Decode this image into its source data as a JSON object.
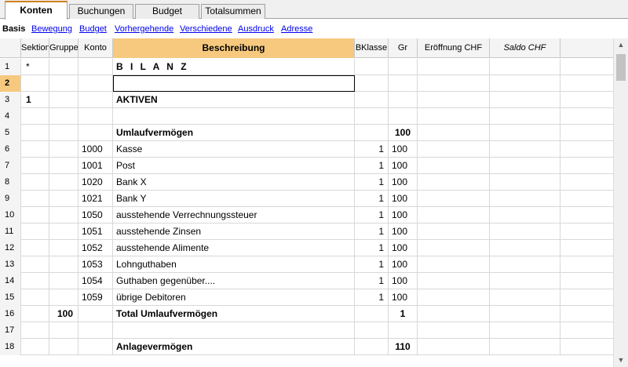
{
  "tabs": [
    {
      "label": "Konten",
      "active": true
    },
    {
      "label": "Buchungen",
      "active": false
    },
    {
      "label": "Budget",
      "active": false
    },
    {
      "label": "Totalsummen",
      "active": false
    }
  ],
  "views": [
    {
      "label": "Basis",
      "active": true
    },
    {
      "label": "Bewegung",
      "active": false
    },
    {
      "label": "Budget",
      "active": false
    },
    {
      "label": "Vorhergehende",
      "active": false
    },
    {
      "label": "Verschiedene",
      "active": false
    },
    {
      "label": "Ausdruck",
      "active": false
    },
    {
      "label": "Adresse",
      "active": false
    }
  ],
  "columns": {
    "rownum": "",
    "sektion": "Sektion",
    "gruppe": "Gruppe",
    "konto": "Konto",
    "beschreibung": "Beschreibung",
    "bklasse": "BKlasse",
    "gr": "Gr",
    "eroeffnung": "Eröffnung CHF",
    "saldo": "Saldo CHF"
  },
  "rows": [
    {
      "n": "1",
      "sektion": "*",
      "gruppe": "",
      "konto": "",
      "beschreibung": "B I L A N Z",
      "bklasse": "",
      "gr": "",
      "style": "spaced"
    },
    {
      "n": "2",
      "sektion": "",
      "gruppe": "",
      "konto": "",
      "beschreibung": "",
      "bklasse": "",
      "gr": "",
      "style": "cursor"
    },
    {
      "n": "3",
      "sektion": "1",
      "gruppe": "",
      "konto": "",
      "beschreibung": "AKTIVEN",
      "bklasse": "",
      "gr": "",
      "style": "bold"
    },
    {
      "n": "4",
      "sektion": "",
      "gruppe": "",
      "konto": "",
      "beschreibung": "",
      "bklasse": "",
      "gr": "",
      "style": ""
    },
    {
      "n": "5",
      "sektion": "",
      "gruppe": "",
      "konto": "",
      "beschreibung": "Umlaufvermögen",
      "bklasse": "",
      "gr": "100",
      "style": "bold"
    },
    {
      "n": "6",
      "sektion": "",
      "gruppe": "",
      "konto": "1000",
      "beschreibung": "Kasse",
      "bklasse": "1",
      "gr": "100",
      "style": ""
    },
    {
      "n": "7",
      "sektion": "",
      "gruppe": "",
      "konto": "1001",
      "beschreibung": "Post",
      "bklasse": "1",
      "gr": "100",
      "style": ""
    },
    {
      "n": "8",
      "sektion": "",
      "gruppe": "",
      "konto": "1020",
      "beschreibung": "Bank X",
      "bklasse": "1",
      "gr": "100",
      "style": ""
    },
    {
      "n": "9",
      "sektion": "",
      "gruppe": "",
      "konto": "1021",
      "beschreibung": "Bank Y",
      "bklasse": "1",
      "gr": "100",
      "style": ""
    },
    {
      "n": "10",
      "sektion": "",
      "gruppe": "",
      "konto": "1050",
      "beschreibung": "ausstehende Verrechnungssteuer",
      "bklasse": "1",
      "gr": "100",
      "style": ""
    },
    {
      "n": "11",
      "sektion": "",
      "gruppe": "",
      "konto": "1051",
      "beschreibung": "ausstehende Zinsen",
      "bklasse": "1",
      "gr": "100",
      "style": ""
    },
    {
      "n": "12",
      "sektion": "",
      "gruppe": "",
      "konto": "1052",
      "beschreibung": "ausstehende Alimente",
      "bklasse": "1",
      "gr": "100",
      "style": ""
    },
    {
      "n": "13",
      "sektion": "",
      "gruppe": "",
      "konto": "1053",
      "beschreibung": "Lohnguthaben",
      "bklasse": "1",
      "gr": "100",
      "style": ""
    },
    {
      "n": "14",
      "sektion": "",
      "gruppe": "",
      "konto": "1054",
      "beschreibung": "Guthaben gegenüber....",
      "bklasse": "1",
      "gr": "100",
      "style": ""
    },
    {
      "n": "15",
      "sektion": "",
      "gruppe": "",
      "konto": "1059",
      "beschreibung": "übrige Debitoren",
      "bklasse": "1",
      "gr": "100",
      "style": ""
    },
    {
      "n": "16",
      "sektion": "",
      "gruppe": "100",
      "konto": "",
      "beschreibung": "Total Umlaufvermögen",
      "bklasse": "",
      "gr": "1",
      "style": "bold"
    },
    {
      "n": "17",
      "sektion": "",
      "gruppe": "",
      "konto": "",
      "beschreibung": "",
      "bklasse": "",
      "gr": "",
      "style": ""
    },
    {
      "n": "18",
      "sektion": "",
      "gruppe": "",
      "konto": "",
      "beschreibung": "Anlagevermögen",
      "bklasse": "",
      "gr": "110",
      "style": "bold"
    }
  ],
  "selected_row": "2",
  "colors": {
    "accent": "#f6c97e",
    "tab_accent": "#d08020",
    "link": "#0000ee"
  }
}
